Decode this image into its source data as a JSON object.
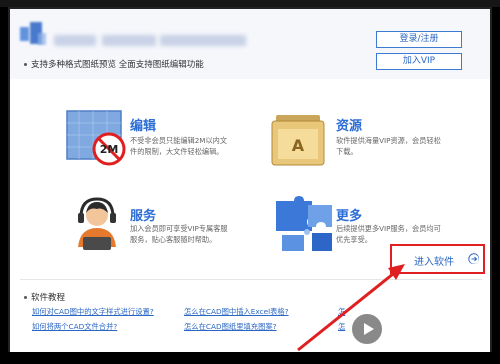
{
  "header": {
    "subtitle": "支持多种格式图纸预览 全面支持图纸编辑功能",
    "login_label": "登录/注册",
    "vip_label": "加入VIP"
  },
  "features": [
    {
      "title": "编辑",
      "desc": "不受非会员只能编辑2M以内文件的限制，大文件轻松编辑。",
      "icon": "blueprint-2m-icon",
      "badge": "2M"
    },
    {
      "title": "资源",
      "desc": "软件提供海量VIP资源，会员轻松下载。",
      "icon": "folder-icon",
      "glyph": "A"
    },
    {
      "title": "服务",
      "desc": "加入会员即可享受VIP专属客服服务，贴心客服随时帮助。",
      "icon": "customer-service-icon"
    },
    {
      "title": "更多",
      "desc": "后续提供更多VIP服务，会员均可优先享受。",
      "icon": "puzzle-icon"
    }
  ],
  "enter": {
    "label": "进入软件"
  },
  "tutorials": {
    "title": "软件教程",
    "links": [
      "如何对CAD图中的文字样式进行设置?",
      "怎么在CAD图中插入Excel表格?",
      "怎",
      "如何将两个CAD文件合并?",
      "怎么在CAD图纸里填充图案?",
      "怎"
    ]
  },
  "watermark": {
    "text": "溜溜自学",
    "sub": "ZIXUE.3D66.COM"
  },
  "colors": {
    "accent": "#2c6dd5",
    "highlight": "#e02020"
  }
}
